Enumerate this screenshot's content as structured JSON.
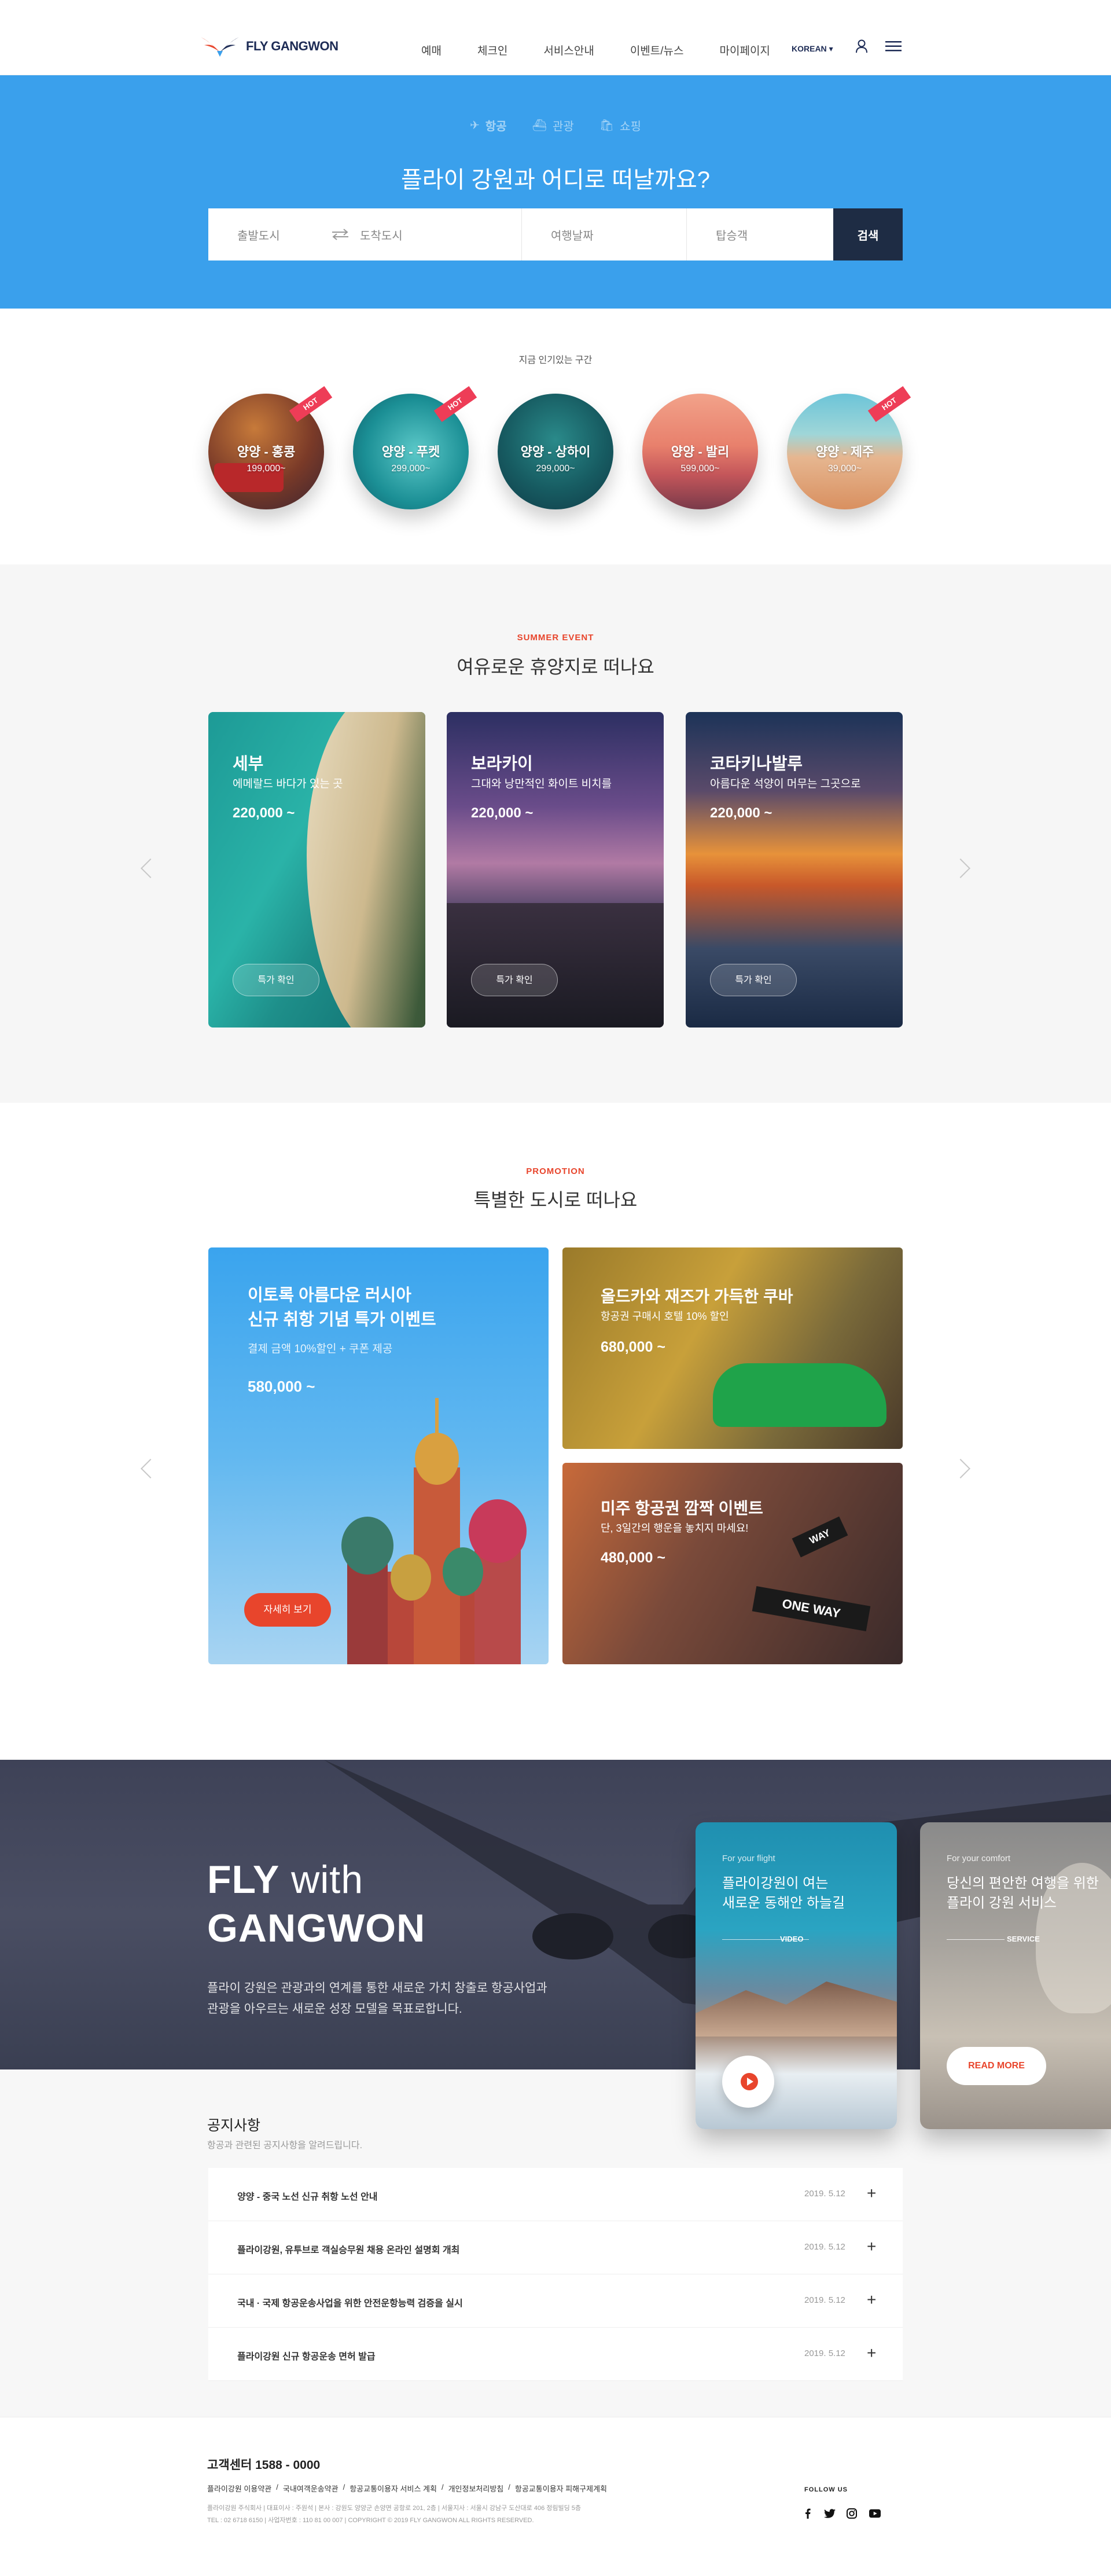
{
  "header": {
    "logo_text": "FLY GANGWON",
    "nav": [
      "예매",
      "체크인",
      "서비스안내",
      "이벤트/뉴스",
      "마이페이지"
    ],
    "lang": "KOREAN"
  },
  "hero": {
    "tabs": [
      "항공",
      "관광",
      "쇼핑"
    ],
    "title": "플라이 강원과 어디로 떠날까요?",
    "search": {
      "from_placeholder": "출발도시",
      "to_placeholder": "도착도시",
      "date_placeholder": "여행날짜",
      "pax_placeholder": "탑승객",
      "button": "검색"
    }
  },
  "popular": {
    "title": "지금 인기있는 구간",
    "badge": "HOT",
    "items": [
      {
        "route": "양양 - 홍콩",
        "price": "199,000~",
        "hot": true
      },
      {
        "route": "양양 - 푸켓",
        "price": "299,000~",
        "hot": true
      },
      {
        "route": "양양 - 상하이",
        "price": "299,000~",
        "hot": false
      },
      {
        "route": "양양 - 발리",
        "price": "599,000~",
        "hot": false
      },
      {
        "route": "양양 - 제주",
        "price": "39,000~",
        "hot": true
      }
    ]
  },
  "summer": {
    "label": "SUMMER EVENT",
    "title": "여유로운 휴양지로 떠나요",
    "cards": [
      {
        "name": "세부",
        "desc": "에메랄드 바다가 있는 곳",
        "price": "220,000 ~",
        "button": "특가 확인"
      },
      {
        "name": "보라카이",
        "desc": "그대와 낭만적인 화이트 비치를",
        "price": "220,000 ~",
        "button": "특가 확인"
      },
      {
        "name": "코타키나발루",
        "desc": "아름다운 석양이 머무는 그곳으로",
        "price": "220,000 ~",
        "button": "특가 확인"
      }
    ]
  },
  "promotion": {
    "label": "PROMOTION",
    "title": "특별한 도시로 떠나요",
    "main": {
      "title1": "이토록 아름다운 러시아",
      "title2": "신규 취항 기념 특가 이벤트",
      "desc": "결제 금액 10%할인 + 쿠폰 제공",
      "price": "580,000 ~",
      "button": "자세히 보기"
    },
    "cuba": {
      "title": "올드카와 재즈가 가득한 쿠바",
      "desc": "항공권 구매시 호텔 10% 할인",
      "price": "680,000 ~"
    },
    "usa": {
      "title": "미주 항공권 깜짝 이벤트",
      "desc": "단, 3일간의 행운을 놓치지 마세요!",
      "price": "480,000 ~",
      "sign1": "ONE WAY",
      "sign2": "WAY"
    }
  },
  "fly": {
    "title_bold1": "FLY",
    "title_light": " with",
    "title_bold2": "GANGWON",
    "desc1": "플라이 강원은 관광과의 연계를 통한 새로운 가치 창출로 항공사업과",
    "desc2": "관광을 아우르는 새로운 성장 모델을 목표로합니다.",
    "card1": {
      "small": "For your flight",
      "t1": "플라이강원이 여는",
      "t2": "새로운 동해안 하늘길",
      "tag": "VIDEO"
    },
    "card2": {
      "small": "For your comfort",
      "t1": "당신의 편안한 여행을 위한",
      "t2": "플라이 강원 서비스",
      "tag": "SERVICE",
      "button": "READ MORE"
    }
  },
  "notice": {
    "title": "공지사항",
    "sub": "항공과 관련된 공지사항을 알려드립니다.",
    "rows": [
      {
        "title": "양양 - 중국 노선 신규 취항 노선 안내",
        "date": "2019. 5.12"
      },
      {
        "title": "플라이강원, 유투브로 객실승무원 채용 온라인 설명회 개최",
        "date": "2019. 5.12"
      },
      {
        "title": "국내 · 국제 항공운송사업을 위한 안전운항능력 검증을 실시",
        "date": "2019. 5.12"
      },
      {
        "title": "플라이강원 신규 항공운송 면허 발급",
        "date": "2019. 5.12"
      }
    ],
    "plus": "+"
  },
  "footer": {
    "cs": "고객센터 1588 - 0000",
    "links": [
      "플라이강원 이용약관",
      "국내여객운송약관",
      "항공교통이용자 서비스 계획",
      "개인정보처리방침",
      "항공교통이용자 피해구제계획"
    ],
    "info1": "플라이강원 주식회사  |  대표이사 : 주원석  |  본사 : 강원도 양양군 손양면 공항로 201, 2층  |  서울지사 : 서울시 강남구 도산대로 406 정림빌딩 5층",
    "info2": "TEL : 02 6718 6150  |  사업자번호 : 110 81 00 007  |  COPYRIGHT © 2019 FLY GANGWON ALL RIGHTS RESERVED.",
    "follow": "FOLLOW US",
    "social": [
      "f",
      "t",
      "ig",
      "yt"
    ]
  },
  "colors": {
    "primary": "#3aa0ec",
    "navy": "#1e2c44",
    "accent": "#e8452c",
    "hot": "#ee3d57"
  }
}
